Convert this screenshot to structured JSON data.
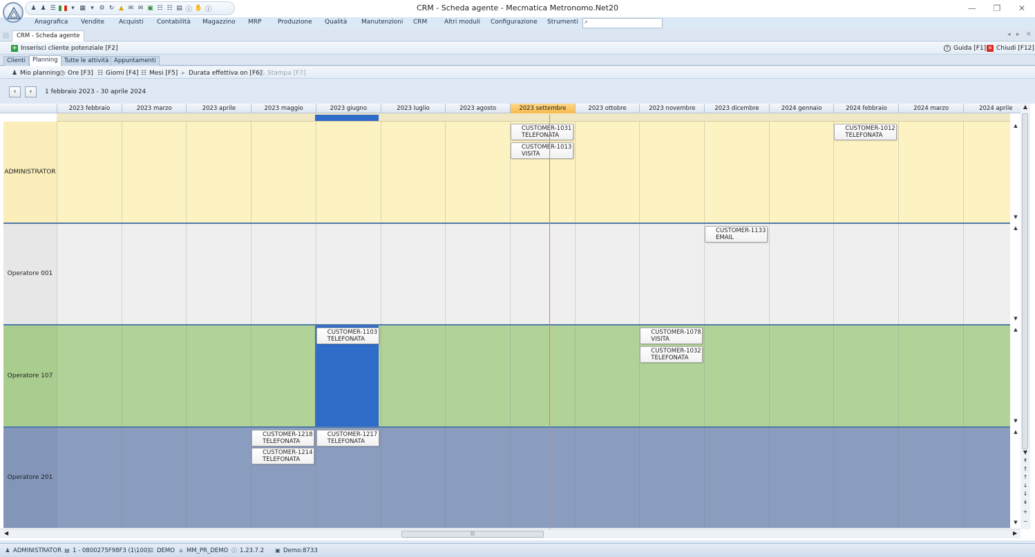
{
  "window": {
    "title": "CRM - Scheda agente - Mecmatica Metronomo.Net20",
    "minimize": "—",
    "restore": "❐",
    "close": "✕"
  },
  "menu": {
    "items": [
      "Anagrafica",
      "Vendite",
      "Acquisti",
      "Contabilità",
      "Magazzino",
      "MRP",
      "Produzione",
      "Qualità",
      "Manutenzioni",
      "CRM",
      "Altri moduli",
      "Configurazione",
      "Strumenti"
    ],
    "search_placeholder": ""
  },
  "doc_tab": {
    "label": "CRM - Scheda agente"
  },
  "toolbar1": {
    "insert_label": "Inserisci cliente potenziale [F2]",
    "help_label": "Guida [F1]",
    "close_label": "Chiudi [F12]"
  },
  "section_tabs": [
    "Clienti",
    "Planning",
    "Tutte le attività",
    "Appuntamenti"
  ],
  "toolbar2": {
    "my_planning": "Mio planning",
    "hours": "Ore [F3]",
    "days": "Giorni [F4]",
    "months": "Mesi [F5]",
    "duration": "Durata effettiva on [F6]",
    "print": "Stampa [F7]"
  },
  "planner": {
    "date_range": "1 febbraio 2023 - 30 aprile 2024",
    "months": [
      "2023 febbraio",
      "2023 marzo",
      "2023 aprile",
      "2023 maggio",
      "2023 giugno",
      "2023 luglio",
      "2023 agosto",
      "2023 settembre",
      "2023 ottobre",
      "2023 novembre",
      "2023 dicembre",
      "2024 gennaio",
      "2024 febbraio",
      "2024 marzo",
      "2024 aprile"
    ],
    "current_month_index": 7,
    "selected_month_index": 4,
    "resources": [
      {
        "name": "ADMINISTRATOR",
        "color": "#fdf2c2",
        "label_color": "#fbeebb",
        "appointments": [
          {
            "month": 7,
            "slot": 0,
            "customer": "CUSTOMER-1031",
            "type": "TELEFONATA"
          },
          {
            "month": 7,
            "slot": 1,
            "customer": "CUSTOMER-1013",
            "type": "VISITA"
          },
          {
            "month": 12,
            "slot": 0,
            "customer": "CUSTOMER-1012",
            "type": "TELEFONATA"
          }
        ]
      },
      {
        "name": "Operatore 001",
        "color": "#efefef",
        "label_color": "#e7e7e7",
        "appointments": [
          {
            "month": 10,
            "slot": 0,
            "customer": "CUSTOMER-1133",
            "type": "EMAIL"
          }
        ]
      },
      {
        "name": "Operatore 107",
        "color": "#b2d398",
        "label_color": "#a9cc8f",
        "appointments": [
          {
            "month": 4,
            "slot": 0,
            "customer": "CUSTOMER-1103",
            "type": "TELEFONATA"
          },
          {
            "month": 9,
            "slot": 0,
            "customer": "CUSTOMER-1078",
            "type": "VISITA"
          },
          {
            "month": 9,
            "slot": 1,
            "customer": "CUSTOMER-1032",
            "type": "TELEFONATA"
          }
        ]
      },
      {
        "name": "Operatore 201",
        "color": "#8a9dbf",
        "label_color": "#8396ba",
        "appointments": [
          {
            "month": 3,
            "slot": 0,
            "customer": "CUSTOMER-1218",
            "type": "TELEFONATA"
          },
          {
            "month": 3,
            "slot": 1,
            "customer": "CUSTOMER-1214",
            "type": "TELEFONATA"
          },
          {
            "month": 4,
            "slot": 0,
            "customer": "CUSTOMER-1217",
            "type": "TELEFONATA"
          }
        ]
      }
    ]
  },
  "statusbar": {
    "user": "ADMINISTRATOR",
    "terminal": "1 - 0800275F98F3 (1\\100)",
    "database": "DEMO",
    "company": "MM_PR_DEMO",
    "version": "1.23.7.2",
    "server": "Demo:8733"
  },
  "colors": {
    "accent": "#2f6bc8",
    "now_line": "#f08030",
    "current_month": "#f7b84b"
  }
}
